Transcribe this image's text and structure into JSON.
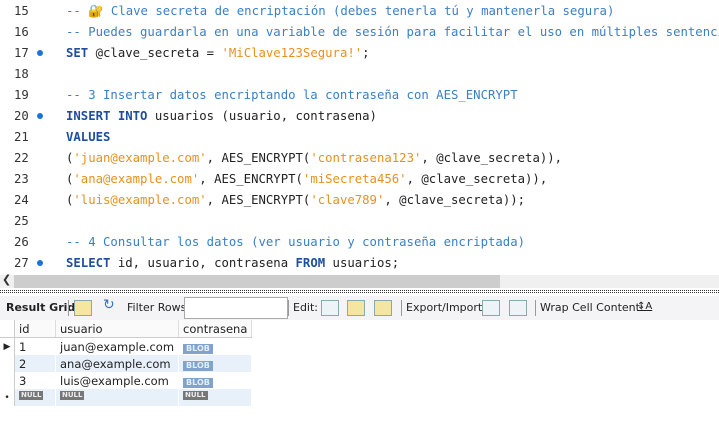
{
  "editor": {
    "lines": [
      {
        "num": "15",
        "bp": false,
        "parts": [
          [
            "c",
            "-- 🔐 Clave secreta de encriptación (debes tenerla tú y mantenerla segura)"
          ]
        ]
      },
      {
        "num": "16",
        "bp": false,
        "parts": [
          [
            "c",
            "-- Puedes guardarla en una variable de sesión para facilitar el uso en múltiples sentencias."
          ]
        ]
      },
      {
        "num": "17",
        "bp": true,
        "parts": [
          [
            "k",
            "SET"
          ],
          [
            "",
            "@clave_secreta = "
          ],
          [
            "s",
            "'MiClave123Segura!'"
          ],
          [
            "",
            ";"
          ]
        ]
      },
      {
        "num": "18",
        "bp": false,
        "parts": []
      },
      {
        "num": "19",
        "bp": false,
        "parts": [
          [
            "c",
            "-- 3 Insertar datos encriptando la contraseña con AES_ENCRYPT"
          ]
        ]
      },
      {
        "num": "20",
        "bp": true,
        "parts": [
          [
            "k",
            "INSERT INTO"
          ],
          [
            "",
            " usuarios (usuario, contrasena)"
          ]
        ]
      },
      {
        "num": "21",
        "bp": false,
        "parts": [
          [
            "k",
            "VALUES"
          ]
        ]
      },
      {
        "num": "22",
        "bp": false,
        "parts": [
          [
            "",
            "("
          ],
          [
            "s",
            "'juan@example.com'"
          ],
          [
            "",
            ", AES_ENCRYPT("
          ],
          [
            "s",
            "'contrasena123'"
          ],
          [
            "",
            ", @clave_secreta)),"
          ]
        ]
      },
      {
        "num": "23",
        "bp": false,
        "parts": [
          [
            "",
            "("
          ],
          [
            "s",
            "'ana@example.com'"
          ],
          [
            "",
            ", AES_ENCRYPT("
          ],
          [
            "s",
            "'miSecreta456'"
          ],
          [
            "",
            ", @clave_secreta)),"
          ]
        ]
      },
      {
        "num": "24",
        "bp": false,
        "parts": [
          [
            "",
            "("
          ],
          [
            "s",
            "'luis@example.com'"
          ],
          [
            "",
            ", AES_ENCRYPT("
          ],
          [
            "s",
            "'clave789'"
          ],
          [
            "",
            ", @clave_secreta));"
          ]
        ]
      },
      {
        "num": "25",
        "bp": false,
        "parts": []
      },
      {
        "num": "26",
        "bp": false,
        "parts": [
          [
            "c",
            "-- 4 Consultar los datos (ver usuario y contraseña encriptada)"
          ]
        ]
      },
      {
        "num": "27",
        "bp": true,
        "parts": [
          [
            "k",
            "SELECT"
          ],
          [
            "",
            " id, usuario, contrasena "
          ],
          [
            "k",
            "FROM"
          ],
          [
            "",
            " usuarios;"
          ]
        ]
      }
    ]
  },
  "toolbar": {
    "result_grid": "Result Grid",
    "filter_rows": "Filter Rows:",
    "filter_value": "",
    "edit": "Edit:",
    "export_import": "Export/Import:",
    "wrap_cell": "Wrap Cell Content:"
  },
  "grid": {
    "columns": [
      "id",
      "usuario",
      "contrasena"
    ],
    "rows": [
      [
        "1",
        "juan@example.com",
        "BLOB"
      ],
      [
        "2",
        "ana@example.com",
        "BLOB"
      ],
      [
        "3",
        "luis@example.com",
        "BLOB"
      ]
    ],
    "null_label": "NULL"
  }
}
